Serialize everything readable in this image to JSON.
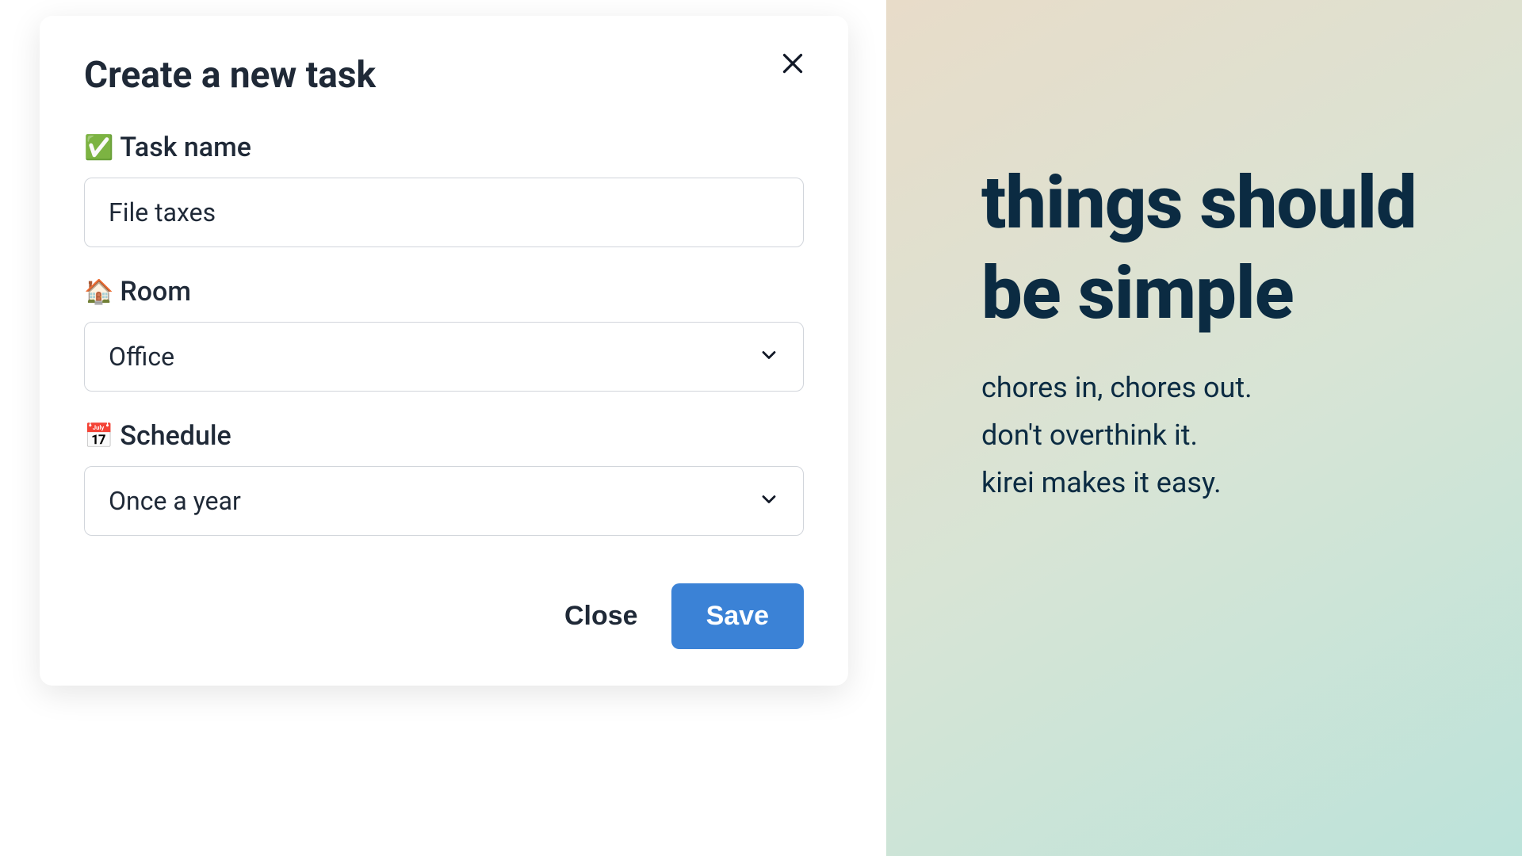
{
  "modal": {
    "title": "Create a new task",
    "fields": {
      "task_name": {
        "icon": "✅",
        "label": "Task name",
        "value": "File taxes"
      },
      "room": {
        "icon": "🏠",
        "label": "Room",
        "value": "Office"
      },
      "schedule": {
        "icon": "📅",
        "label": "Schedule",
        "value": "Once a year"
      }
    },
    "buttons": {
      "close": "Close",
      "save": "Save"
    }
  },
  "marketing": {
    "headline": "things should be simple",
    "tagline_line1": "chores in, chores out.",
    "tagline_line2": "don't overthink it.",
    "tagline_line3": "kirei makes it easy."
  }
}
